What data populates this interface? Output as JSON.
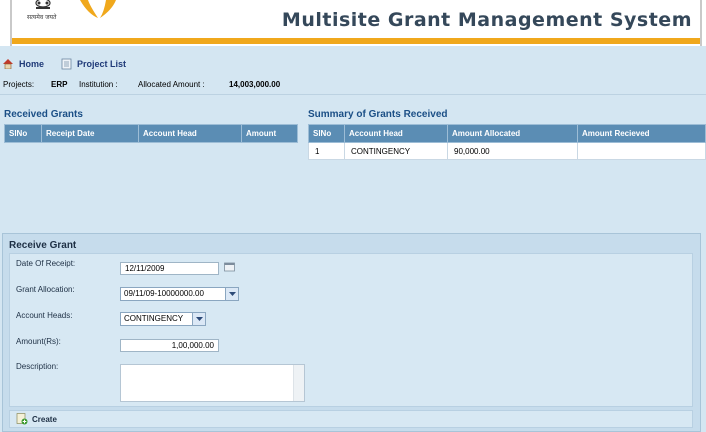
{
  "header": {
    "motto": "सत्यमेव जयते",
    "title": "Multisite Grant Management System"
  },
  "nav": {
    "home_label": "Home",
    "project_list_label": "Project List"
  },
  "info": {
    "projects_label": "Projects:",
    "projects_value": "ERP",
    "institution_label": "Institution :",
    "institution_value": "",
    "allocated_label": "Allocated Amount :",
    "allocated_value": "14,003,000.00"
  },
  "received_grants": {
    "title": "Received Grants",
    "columns": [
      "SlNo",
      "Receipt Date",
      "Account Head",
      "Amount"
    ],
    "rows": []
  },
  "summary": {
    "title": "Summary of Grants Received",
    "columns": [
      "SlNo",
      "Account Head",
      "Amount Allocated",
      "Amount Recieved"
    ],
    "rows": [
      [
        "1",
        "CONTINGENCY",
        "90,000.00",
        ""
      ]
    ]
  },
  "receive_grant": {
    "title": "Receive Grant",
    "date_label": "Date Of Receipt:",
    "date_value": "12/11/2009",
    "allocation_label": "Grant Allocation:",
    "allocation_value": "09/11/09-10000000.00",
    "heads_label": "Account Heads:",
    "heads_value": "CONTINGENCY",
    "amount_label": "Amount(Rs):",
    "amount_value": "1,00,000.00",
    "description_label": "Description:",
    "description_value": "",
    "create_label": "Create"
  },
  "icons": {
    "home": "home-icon",
    "project_list": "document-icon",
    "calendar": "calendar-icon",
    "create": "add-document-icon"
  },
  "colors": {
    "accent_gold": "#f0a81c",
    "table_header": "#5b8db4",
    "section_title": "#1b4f86",
    "background": "#d4e6f2"
  }
}
